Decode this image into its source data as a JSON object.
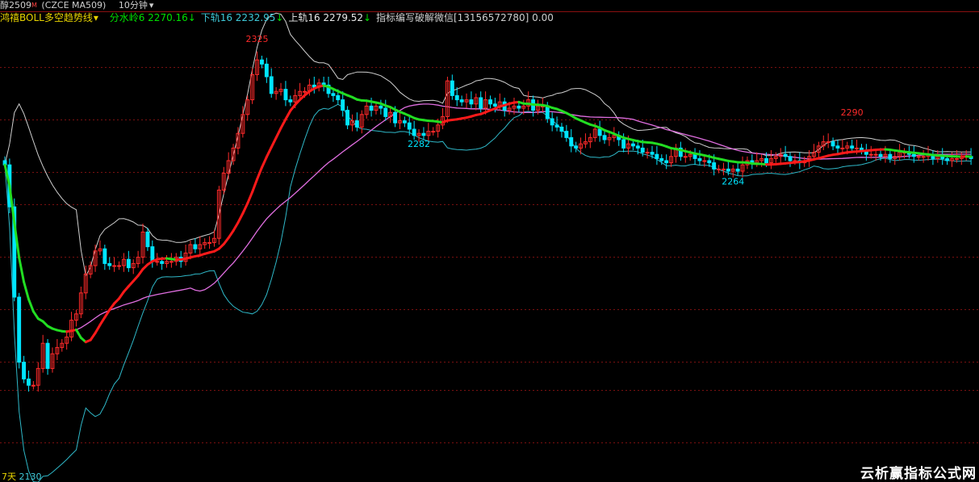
{
  "header": {
    "symbol": "醇2509",
    "marker": "M",
    "exchange": "(CZCE MA509)",
    "period": "10分钟",
    "period_arrow": "▾"
  },
  "legend": {
    "indicator_name": "鸿禧BOLL多空趋势线",
    "indicator_arrow": "▾",
    "items": [
      {
        "label": "分水岭6",
        "value": "2270.16",
        "arrow": "↓",
        "color": "#00e000"
      },
      {
        "label": "下轨16",
        "value": "2232.95",
        "arrow": "↓",
        "color": "#3fc9d8"
      },
      {
        "label": "上轨16",
        "value": "2279.52",
        "arrow": "↓",
        "color": "#e8e8e8"
      },
      {
        "label": "指标编写破解微信[13156572780]",
        "value": "0.00",
        "arrow": "",
        "color": "#cfcfcf"
      }
    ]
  },
  "annotations": {
    "high_label": "2325",
    "low_label_1": "2282",
    "low_label_2": "2264",
    "high_label_2": "2290",
    "bottom_price": "2130",
    "bottom_tag": "7天"
  },
  "watermark": "云析赢指标公式网",
  "colors": {
    "background": "#000000",
    "up": "#ff2a2a",
    "down": "#00e5ff",
    "midline_bull": "#ff1a1a",
    "midline_bear": "#22dd22",
    "lower_band": "#2fb8c8",
    "upper_band": "#cfcfcf",
    "ma_line": "#e06ee0",
    "grid": "#7a1010"
  },
  "chart_data": {
    "type": "candlestick",
    "x": [
      1,
      2,
      3,
      4,
      5,
      6,
      7,
      8,
      9,
      10,
      11,
      12,
      13,
      14,
      15,
      16,
      17,
      18,
      19,
      20,
      21,
      22,
      23,
      24,
      25,
      26,
      27,
      28,
      29,
      30,
      31,
      32,
      33,
      34,
      35,
      36,
      37,
      38,
      39,
      40,
      41,
      42,
      43,
      44,
      45,
      46,
      47,
      48,
      49,
      50,
      51,
      52,
      53,
      54,
      55,
      56,
      57,
      58,
      59,
      60,
      61,
      62,
      63,
      64,
      65,
      66,
      67,
      68,
      69,
      70,
      71,
      72,
      73,
      74,
      75,
      76,
      77,
      78,
      79,
      80,
      81,
      82,
      83,
      84,
      85,
      86,
      87,
      88,
      89,
      90,
      91,
      92,
      93,
      94,
      95,
      96,
      97,
      98,
      99,
      100,
      101,
      102,
      103,
      104,
      105,
      106,
      107,
      108,
      109,
      110,
      111,
      112,
      113,
      114,
      115,
      116,
      117,
      118,
      119,
      120,
      121,
      122,
      123,
      124,
      125,
      126,
      127,
      128,
      129,
      130,
      131,
      132,
      133,
      134,
      135,
      136,
      137,
      138,
      139,
      140,
      141,
      142,
      143,
      144,
      145,
      146,
      147,
      148,
      149,
      150,
      151,
      152,
      153,
      154,
      155,
      156,
      157,
      158,
      159,
      160,
      161,
      162,
      163,
      164,
      165,
      166,
      167,
      168,
      169,
      170,
      171,
      172,
      173,
      174,
      175,
      176,
      177,
      178,
      179,
      180,
      181,
      182,
      183,
      184,
      185,
      186,
      187,
      188,
      189,
      190,
      191,
      192,
      193,
      194,
      195,
      196,
      197,
      198,
      199,
      200,
      201,
      202,
      203,
      204
    ],
    "open": [
      2270,
      2268,
      2248,
      2205,
      2174,
      2166,
      2163,
      2163,
      2171,
      2183,
      2171,
      2178,
      2181,
      2183,
      2186,
      2194,
      2197,
      2207,
      2216,
      2220,
      2227,
      2228,
      2221,
      2220,
      2220,
      2220,
      2223,
      2219,
      2221,
      2224,
      2236,
      2229,
      2222,
      2222,
      2221,
      2222,
      2222,
      2224,
      2222,
      2226,
      2230,
      2228,
      2230,
      2231,
      2231,
      2233,
      2256,
      2264,
      2270,
      2276,
      2283,
      2292,
      2299,
      2311,
      2318,
      2316,
      2310,
      2302,
      2303,
      2304,
      2299,
      2298,
      2301,
      2303,
      2303,
      2306,
      2305,
      2307,
      2306,
      2302,
      2301,
      2299,
      2294,
      2287,
      2289,
      2286,
      2292,
      2296,
      2294,
      2296,
      2295,
      2291,
      2293,
      2288,
      2289,
      2288,
      2285,
      2282,
      2283,
      2282,
      2284,
      2284,
      2287,
      2291,
      2308,
      2301,
      2299,
      2298,
      2299,
      2297,
      2300,
      2295,
      2299,
      2297,
      2296,
      2298,
      2294,
      2295,
      2296,
      2295,
      2296,
      2299,
      2294,
      2296,
      2296,
      2290,
      2287,
      2286,
      2284,
      2281,
      2277,
      2276,
      2278,
      2279,
      2281,
      2285,
      2282,
      2280,
      2281,
      2282,
      2280,
      2276,
      2278,
      2277,
      2276,
      2274,
      2274,
      2273,
      2271,
      2270,
      2269,
      2272,
      2276,
      2272,
      2272,
      2273,
      2271,
      2270,
      2270,
      2269,
      2266,
      2266,
      2266,
      2265,
      2266,
      2265,
      2268,
      2270,
      2269,
      2270,
      2271,
      2269,
      2271,
      2272,
      2273,
      2272,
      2270,
      2270,
      2269,
      2270,
      2272,
      2274,
      2277,
      2279,
      2279,
      2277,
      2276,
      2276,
      2277,
      2276,
      2276,
      2275,
      2273,
      2273,
      2273,
      2272,
      2273,
      2271,
      2272,
      2274,
      2274,
      2273,
      2272,
      2272,
      2272,
      2273,
      2271,
      2272,
      2271,
      2270,
      2271,
      2271,
      2272,
      2272
    ],
    "close": [
      2268,
      2248,
      2205,
      2174,
      2166,
      2163,
      2163,
      2171,
      2183,
      2171,
      2178,
      2181,
      2183,
      2186,
      2194,
      2197,
      2207,
      2216,
      2220,
      2227,
      2228,
      2221,
      2220,
      2220,
      2220,
      2223,
      2219,
      2221,
      2224,
      2236,
      2229,
      2222,
      2222,
      2221,
      2222,
      2222,
      2224,
      2222,
      2226,
      2230,
      2228,
      2230,
      2231,
      2231,
      2233,
      2256,
      2264,
      2270,
      2276,
      2283,
      2292,
      2299,
      2311,
      2318,
      2316,
      2310,
      2302,
      2303,
      2304,
      2299,
      2298,
      2301,
      2303,
      2303,
      2306,
      2305,
      2307,
      2306,
      2302,
      2301,
      2299,
      2294,
      2287,
      2289,
      2286,
      2292,
      2296,
      2294,
      2296,
      2295,
      2291,
      2293,
      2288,
      2289,
      2288,
      2285,
      2282,
      2283,
      2282,
      2284,
      2284,
      2287,
      2291,
      2308,
      2301,
      2299,
      2298,
      2299,
      2297,
      2300,
      2295,
      2299,
      2297,
      2296,
      2298,
      2294,
      2295,
      2296,
      2295,
      2296,
      2299,
      2294,
      2296,
      2296,
      2290,
      2287,
      2286,
      2284,
      2281,
      2277,
      2276,
      2278,
      2279,
      2281,
      2285,
      2282,
      2280,
      2281,
      2282,
      2280,
      2276,
      2278,
      2277,
      2276,
      2274,
      2274,
      2273,
      2271,
      2270,
      2269,
      2272,
      2276,
      2272,
      2272,
      2273,
      2271,
      2270,
      2270,
      2269,
      2266,
      2266,
      2266,
      2265,
      2266,
      2265,
      2268,
      2270,
      2269,
      2270,
      2271,
      2269,
      2271,
      2272,
      2273,
      2272,
      2270,
      2270,
      2269,
      2270,
      2272,
      2274,
      2277,
      2279,
      2279,
      2277,
      2276,
      2276,
      2277,
      2276,
      2276,
      2275,
      2273,
      2273,
      2273,
      2272,
      2273,
      2271,
      2272,
      2274,
      2274,
      2273,
      2272,
      2272,
      2272,
      2273,
      2271,
      2272,
      2271,
      2270,
      2271,
      2271,
      2272,
      2272,
      2271
    ]
  }
}
